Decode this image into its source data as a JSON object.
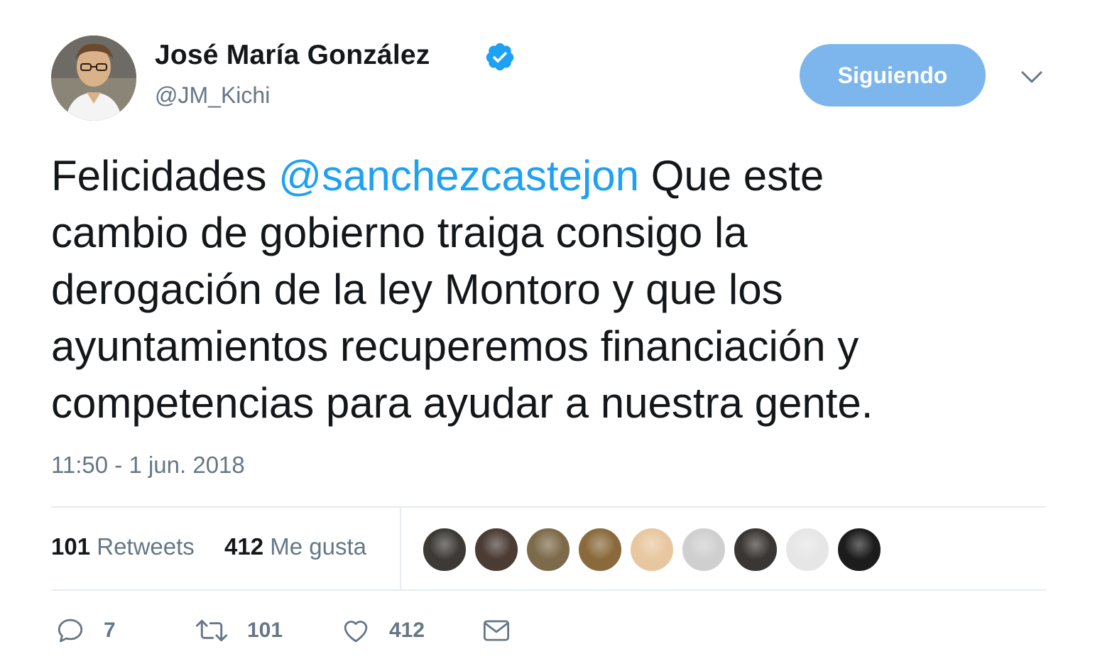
{
  "tweet": {
    "author": {
      "name": "José María González",
      "handle": "@JM_Kichi",
      "verified_icon": "verified-badge-icon",
      "avatar_icon": "profile-photo"
    },
    "follow_button_label": "Siguiendo",
    "menu_icon": "chevron-down-icon",
    "text": {
      "line1_pre": "Felicidades ",
      "mention": "@sanchezcastejon",
      "line1_post": "  Que este",
      "line2": "cambio de gobierno traiga consigo la",
      "line3": "derogación de la ley Montoro y que los",
      "line4": "ayuntamientos recuperemos financiación y",
      "line5": "competencias para ayudar a nuestra gente."
    },
    "timestamp": "11:50 - 1 jun. 2018",
    "stats": {
      "retweets_count": "101",
      "retweets_label": "Retweets",
      "likes_count": "412",
      "likes_label": "Me gusta"
    },
    "liker_avatars": [
      {
        "name": "liker-avatar-1",
        "color": "#3d3a36"
      },
      {
        "name": "liker-avatar-2",
        "color": "#4a3b33"
      },
      {
        "name": "liker-avatar-3",
        "color": "#7d6a4b"
      },
      {
        "name": "liker-avatar-4",
        "color": "#8a6a3c"
      },
      {
        "name": "liker-avatar-5",
        "color": "#e8c7a0"
      },
      {
        "name": "liker-avatar-6",
        "color": "#cfcfcf"
      },
      {
        "name": "liker-avatar-7",
        "color": "#3a3633"
      },
      {
        "name": "liker-avatar-8",
        "color": "#e6e6e6"
      },
      {
        "name": "liker-avatar-9",
        "color": "#1c1c1c"
      }
    ],
    "actions": {
      "reply_count": "7",
      "retweet_count": "101",
      "like_count": "412"
    },
    "colors": {
      "accent": "#1da1f2",
      "follow_button_bg": "#7cb6ec",
      "secondary_text": "#657786",
      "primary_text": "#14171a",
      "divider": "#e6ecf0"
    }
  }
}
